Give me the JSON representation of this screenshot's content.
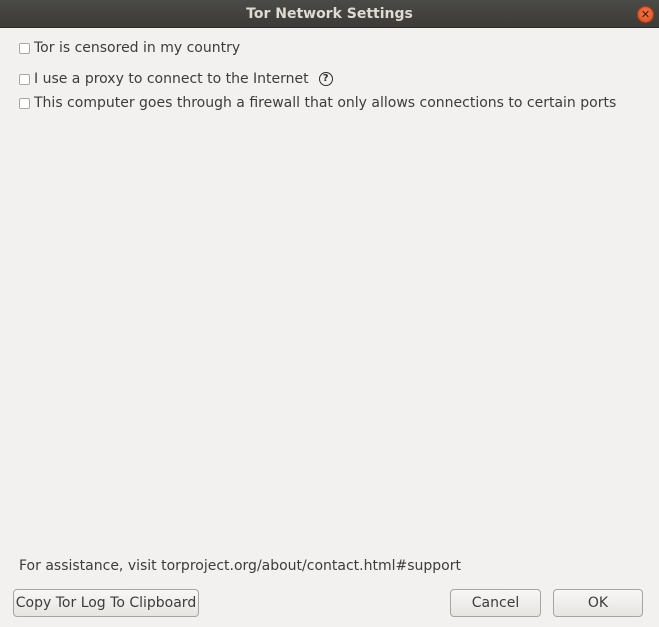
{
  "window": {
    "title": "Tor Network Settings"
  },
  "options": [
    {
      "label": "Tor is censored in my country",
      "checked": false
    },
    {
      "label": "I use a proxy to connect to the Internet",
      "checked": false
    },
    {
      "label": "This computer goes through a firewall that only allows connections to certain ports",
      "checked": false
    }
  ],
  "help_icon_glyph": "?",
  "assistance": {
    "text": "For assistance, visit torproject.org/about/contact.html#support"
  },
  "buttons": {
    "copy_log": "Copy Tor Log To Clipboard",
    "cancel": "Cancel",
    "ok": "OK"
  }
}
